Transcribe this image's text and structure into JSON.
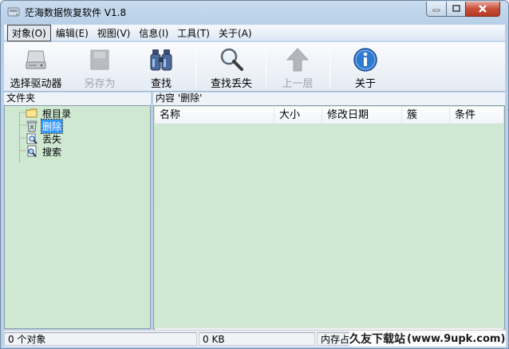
{
  "window": {
    "title": "茫海数据恢复软件 V1.8",
    "min_glyph": "—",
    "max_glyph": "☐",
    "close_glyph": "✕"
  },
  "menu": [
    {
      "label": "对象(O)",
      "active": true
    },
    {
      "label": "编辑(E)"
    },
    {
      "label": "视图(V)"
    },
    {
      "label": "信息(I)"
    },
    {
      "label": "工具(T)"
    },
    {
      "label": "关于(A)"
    }
  ],
  "toolbar": [
    {
      "label": "选择驱动器",
      "icon": "drive-icon",
      "enabled": true
    },
    {
      "label": "另存为",
      "icon": "save-as-icon",
      "enabled": false
    },
    {
      "label": "查找",
      "icon": "binoculars-icon",
      "enabled": true
    },
    {
      "label": "查找丢失",
      "icon": "magnifier-icon",
      "enabled": true
    },
    {
      "label": "上一层",
      "icon": "up-arrow-icon",
      "enabled": false
    },
    {
      "label": "关于",
      "icon": "info-icon",
      "enabled": true
    }
  ],
  "left_pane": {
    "header": "文件夹",
    "tree": [
      {
        "label": "根目录",
        "icon": "folder-icon",
        "selected": false
      },
      {
        "label": "删除",
        "icon": "recycle-bin-icon",
        "selected": true
      },
      {
        "label": "丢失",
        "icon": "lost-search-icon",
        "selected": false
      },
      {
        "label": "搜索",
        "icon": "search-doc-icon",
        "selected": false
      }
    ]
  },
  "right_pane": {
    "header": "内容 '删除'",
    "columns": [
      "名称",
      "大小",
      "修改日期",
      "簇",
      "条件"
    ],
    "rows": []
  },
  "status": {
    "objects": "0 个对象",
    "size": "0 KB",
    "memory": "内存占"
  },
  "watermark": {
    "text_a": "久友下载站",
    "text_b": "(www.9upk.com)"
  },
  "colors": {
    "list_bg": "#cfe8d1",
    "selection": "#3399ff",
    "close_button": "#c7503a"
  }
}
